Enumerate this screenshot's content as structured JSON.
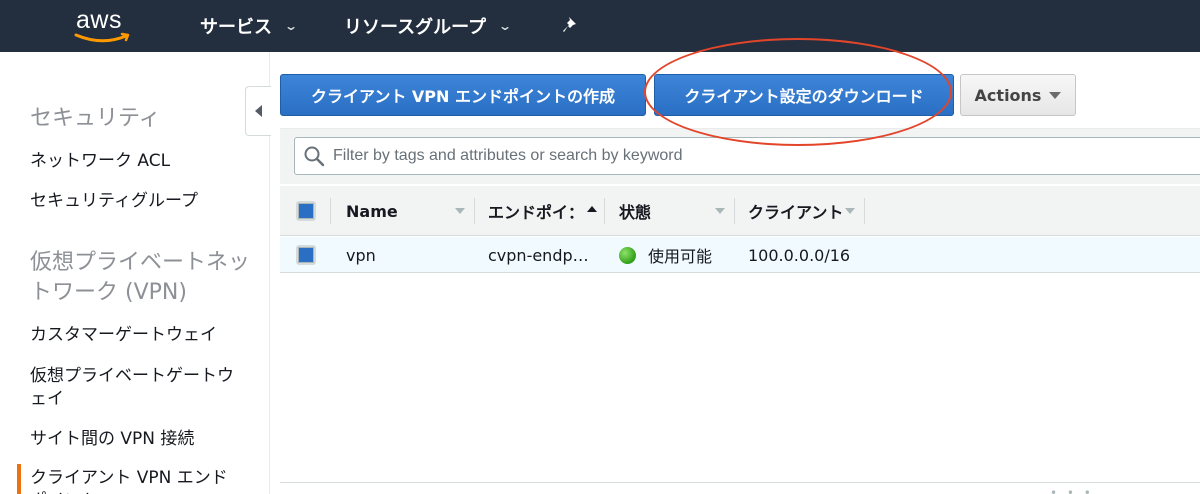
{
  "topnav": {
    "logo_text": "aws",
    "services_label": "サービス",
    "resource_groups_label": "リソースグループ",
    "chevron": "⌄",
    "pin_icon": "pin-icon"
  },
  "sidebar": {
    "security_heading": "セキュリティ",
    "security_items": [
      "ネットワーク ACL",
      "セキュリティグループ"
    ],
    "vpn_heading": "仮想プライベートネットワーク (VPN)",
    "vpn_items": [
      "カスタマーゲートウェイ",
      "仮想プライベートゲートウェイ",
      "サイト間の VPN 接続",
      "クライアント VPN エンドポイント"
    ]
  },
  "toolbar": {
    "create_label": "クライアント VPN エンドポイントの作成",
    "download_label": "クライアント設定のダウンロード",
    "actions_label": "Actions"
  },
  "search": {
    "placeholder": "Filter by tags and attributes or search by keyword"
  },
  "table": {
    "columns": [
      "Name",
      "エンドポイ：",
      "状態",
      "クライアント"
    ],
    "rows": [
      {
        "name": "vpn",
        "endpoint": "cvpn-endp…",
        "status": "使用可能",
        "client": "100.0.0.0/16"
      }
    ]
  },
  "colors": {
    "nav_bg": "#232f3e",
    "primary": "#2a6fc4",
    "accent": "#ec7211",
    "highlight": "#e2452a",
    "status_ok": "#2f9e18"
  }
}
